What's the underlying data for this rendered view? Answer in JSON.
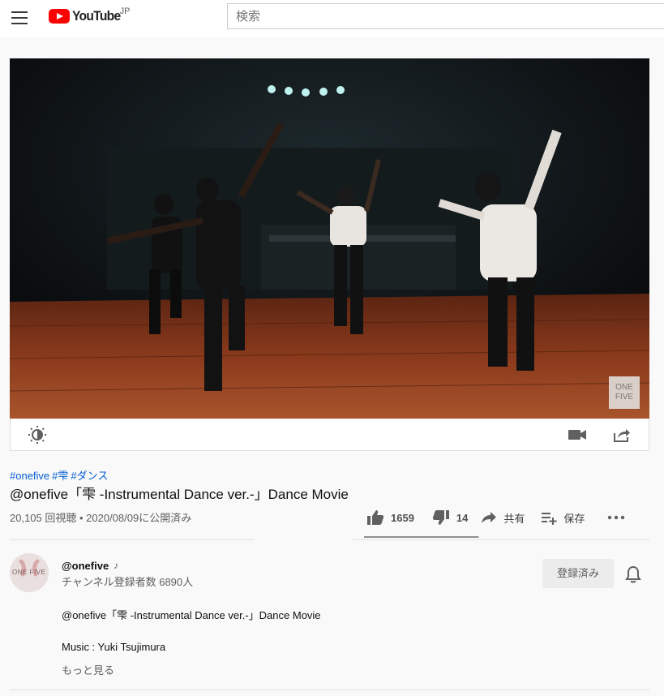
{
  "header": {
    "logo_text": "YouTube",
    "country": "JP",
    "search_placeholder": "検索"
  },
  "player": {
    "watermark": "ONE FIVE"
  },
  "video": {
    "hashtags": [
      "#onefive",
      "#雫",
      "#ダンス"
    ],
    "title": "@onefive「雫 -Instrumental Dance ver.-」Dance Movie",
    "meta": "20,105 回視聴 • 2020/08/09に公開済み",
    "likes": "1659",
    "dislikes": "14",
    "like_ratio": 0.9916,
    "share_label": "共有",
    "save_label": "保存"
  },
  "owner": {
    "avatar_text": "ONE FIVE",
    "channel_name": "@onefive",
    "channel_note": "♪",
    "subscribers": "チャンネル登録者数 6890人",
    "subscribe_label": "登録済み"
  },
  "description": {
    "line1": "@onefive「雫 -Instrumental Dance ver.-」Dance Movie",
    "line2": "Music : Yuki Tsujimura",
    "more_label": "もっと見る"
  },
  "colors": {
    "brand_red": "#ff0000",
    "link_blue": "#065fd4"
  }
}
